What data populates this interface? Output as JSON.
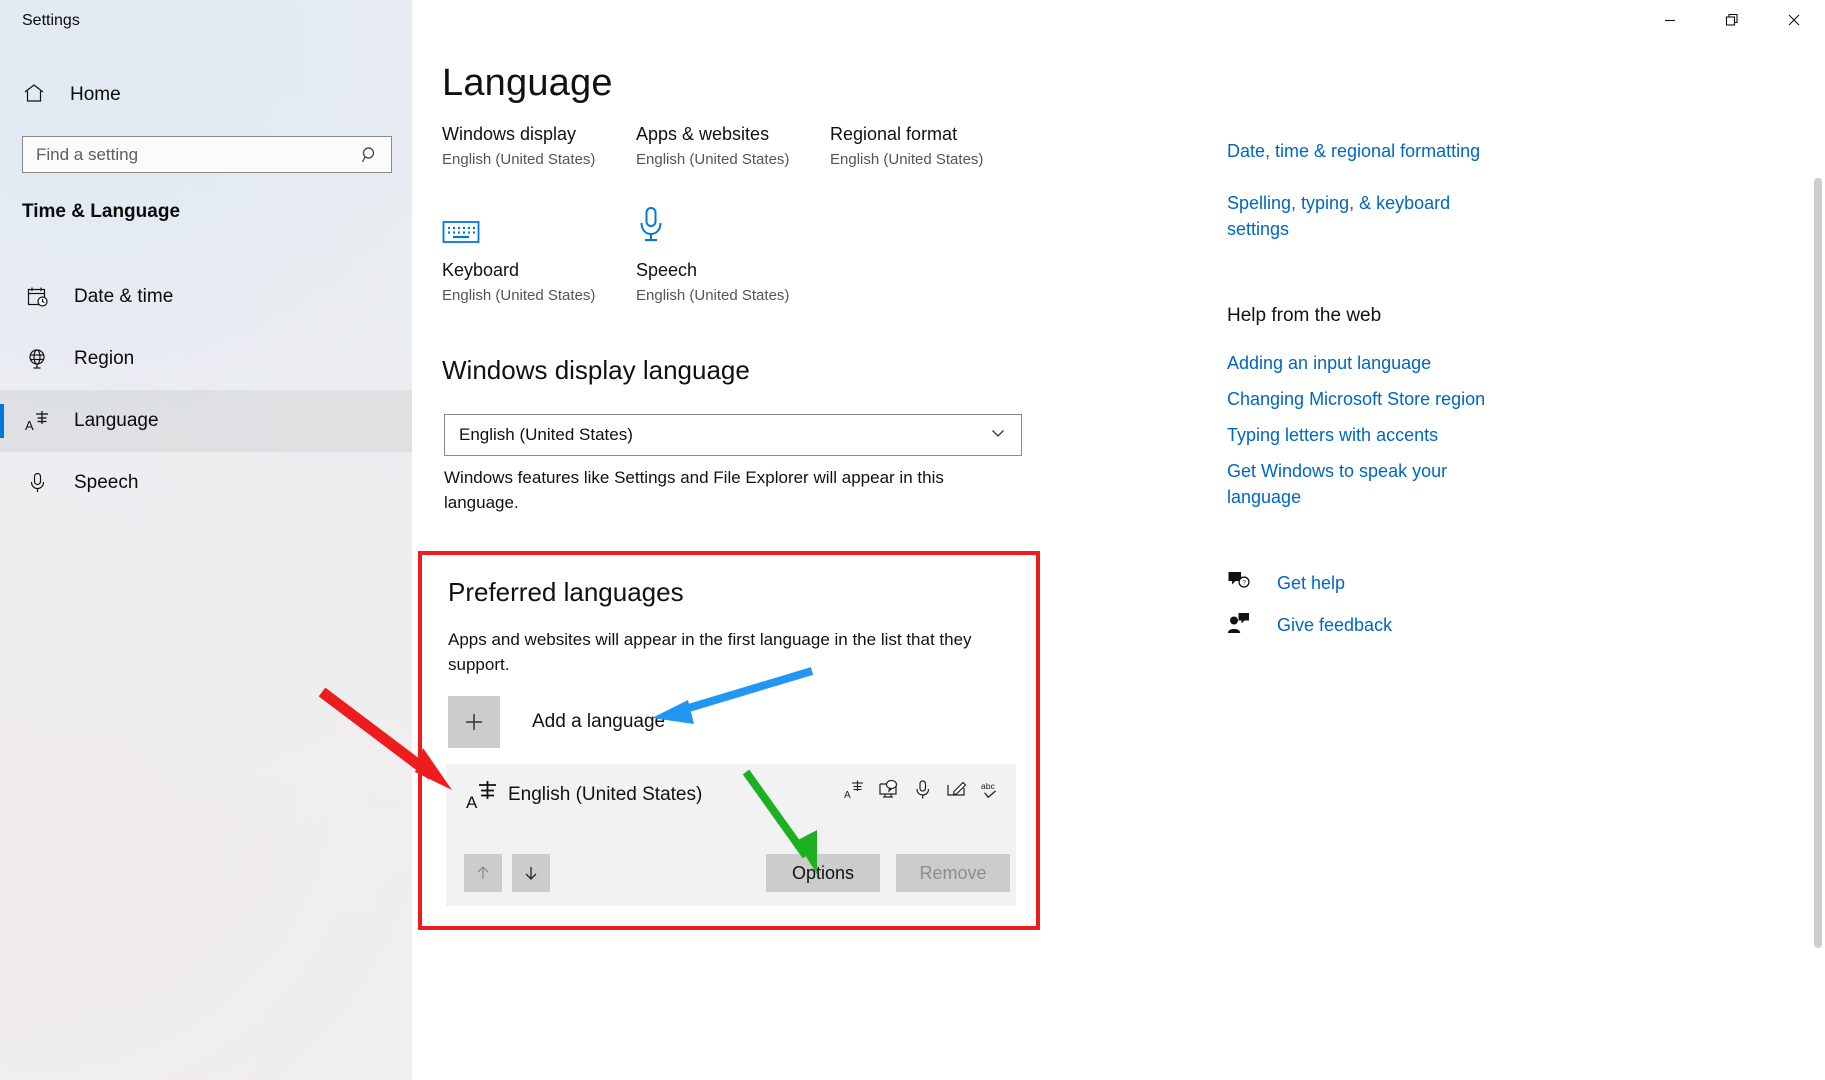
{
  "window": {
    "title": "Settings",
    "controls": {
      "minimize": "Minimize",
      "restore": "Restore",
      "close": "Close"
    }
  },
  "sidebar": {
    "home_label": "Home",
    "search": {
      "placeholder": "Find a setting",
      "value": "",
      "icon": "search-icon"
    },
    "group_label": "Time & Language",
    "items": [
      {
        "label": "Date & time",
        "icon": "calendar-clock-icon",
        "active": false
      },
      {
        "label": "Region",
        "icon": "globe-icon",
        "active": false
      },
      {
        "label": "Language",
        "icon": "language-a-icon",
        "active": true
      },
      {
        "label": "Speech",
        "icon": "microphone-icon",
        "active": false
      }
    ]
  },
  "main": {
    "page_title": "Language",
    "summary_row1": [
      {
        "title": "Windows display",
        "subtitle": "English (United States)"
      },
      {
        "title": "Apps & websites",
        "subtitle": "English (United States)"
      },
      {
        "title": "Regional format",
        "subtitle": "English (United States)"
      }
    ],
    "summary_row2": [
      {
        "title": "Keyboard",
        "subtitle": "English (United States)",
        "icon": "keyboard-icon"
      },
      {
        "title": "Speech",
        "subtitle": "English (United States)",
        "icon": "microphone-icon"
      }
    ],
    "display_language": {
      "heading": "Windows display language",
      "selected": "English (United States)",
      "description": "Windows features like Settings and File Explorer will appear in this language."
    },
    "preferred_languages": {
      "heading": "Preferred languages",
      "description": "Apps and websites will appear in the first language in the list that they support.",
      "add_label": "Add a language",
      "language": {
        "name": "English (United States)",
        "icon": "language-a-icon",
        "feature_icons": [
          "language-pack-icon",
          "display-language-icon",
          "speech-icon",
          "handwriting-icon",
          "spellcheck-icon"
        ]
      },
      "move_up_label": "Move up",
      "move_down_label": "Move down",
      "options_label": "Options",
      "remove_label": "Remove",
      "remove_disabled": true
    }
  },
  "rail": {
    "related_links": [
      "Date, time & regional formatting",
      "Spelling, typing, & keyboard settings"
    ],
    "help_heading": "Help from the web",
    "help_links": [
      "Adding an input language",
      "Changing Microsoft Store region",
      "Typing letters with accents",
      "Get Windows to speak your language"
    ],
    "support": [
      {
        "label": "Get help",
        "icon": "help-bubble-icon"
      },
      {
        "label": "Give feedback",
        "icon": "feedback-person-icon"
      }
    ]
  },
  "annotations": {
    "colors": {
      "red": "#ee1c1c",
      "blue": "#2196f3",
      "green": "#1db021"
    }
  }
}
